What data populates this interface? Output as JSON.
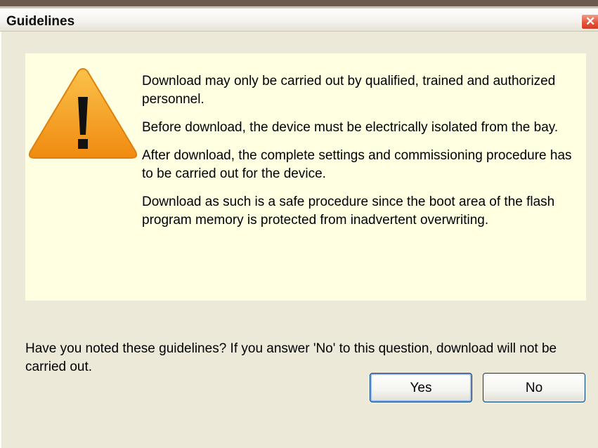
{
  "window": {
    "title": "Guidelines",
    "close_glyph": "✕"
  },
  "guidelines": {
    "icon": "warning-icon",
    "paragraphs": [
      "Download may only be carried out by qualified, trained and authorized personnel.",
      "Before download, the device must be electrically isolated from the bay.",
      "After download, the complete settings and commissioning procedure has to be carried out for the device.",
      "Download as such is a safe procedure since the boot area of the flash program memory is protected from inadvertent overwriting."
    ]
  },
  "question": "Have you noted these guidelines? If you answer 'No' to this question, download will not be carried out.",
  "buttons": {
    "yes_label": "Yes",
    "no_label": "No"
  },
  "colors": {
    "panel_background": "#ffffe1",
    "dialog_background": "#ece9d8",
    "warning_orange": "#f59b1a",
    "close_red": "#e4553c"
  }
}
